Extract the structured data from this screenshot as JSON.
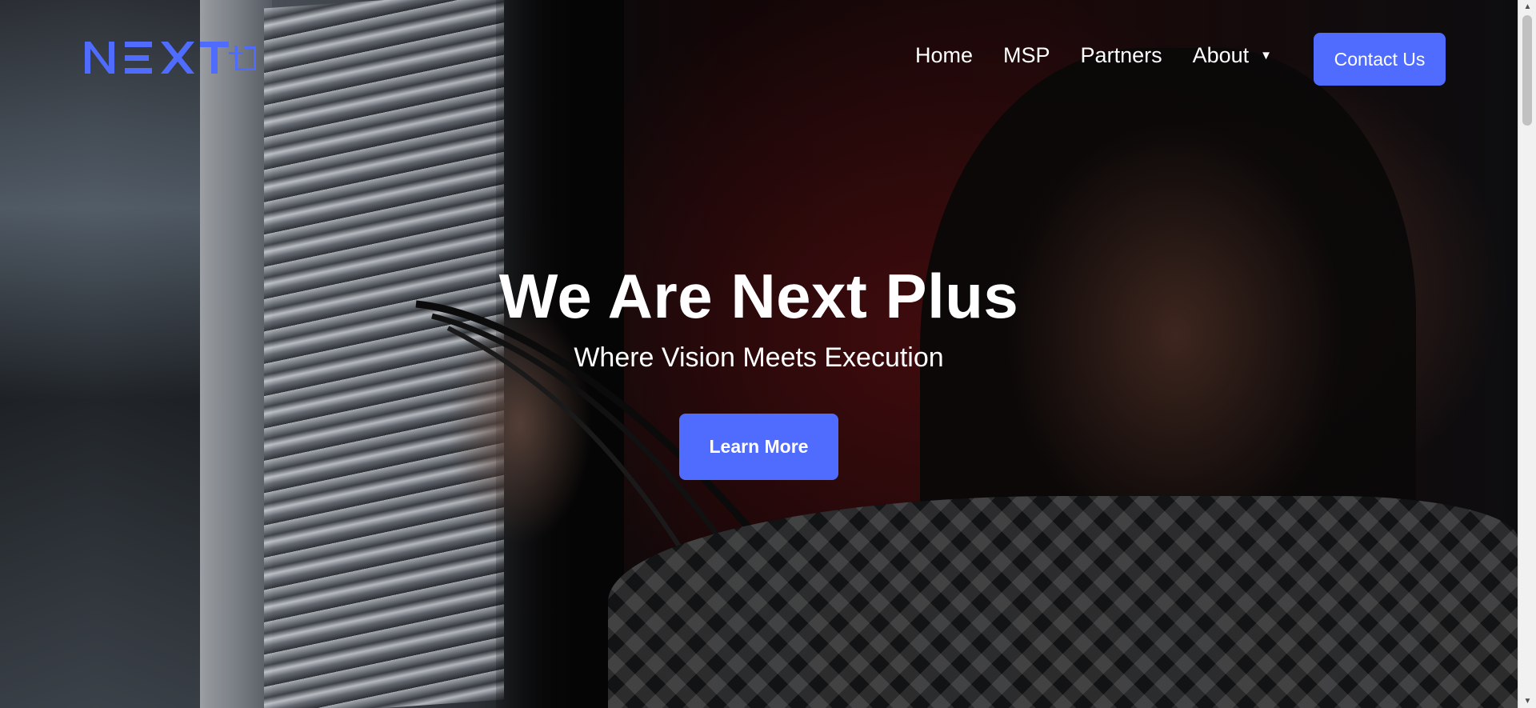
{
  "brand": {
    "logo_text": "NEXT+",
    "logo_color": "#4f6cff"
  },
  "nav": {
    "items": [
      {
        "label": "Home"
      },
      {
        "label": "MSP"
      },
      {
        "label": "Partners"
      }
    ],
    "about_label": "About",
    "about_caret": "▼",
    "contact_label": "Contact Us"
  },
  "hero": {
    "title": "We Are Next Plus",
    "subtitle": "Where Vision Meets Execution",
    "cta_label": "Learn More",
    "background_image": "technician-connecting-cables-server-rack"
  },
  "colors": {
    "accent": "#4f6cff",
    "text": "#ffffff"
  },
  "scrollbar": {
    "up": "▲",
    "down": "▼"
  }
}
